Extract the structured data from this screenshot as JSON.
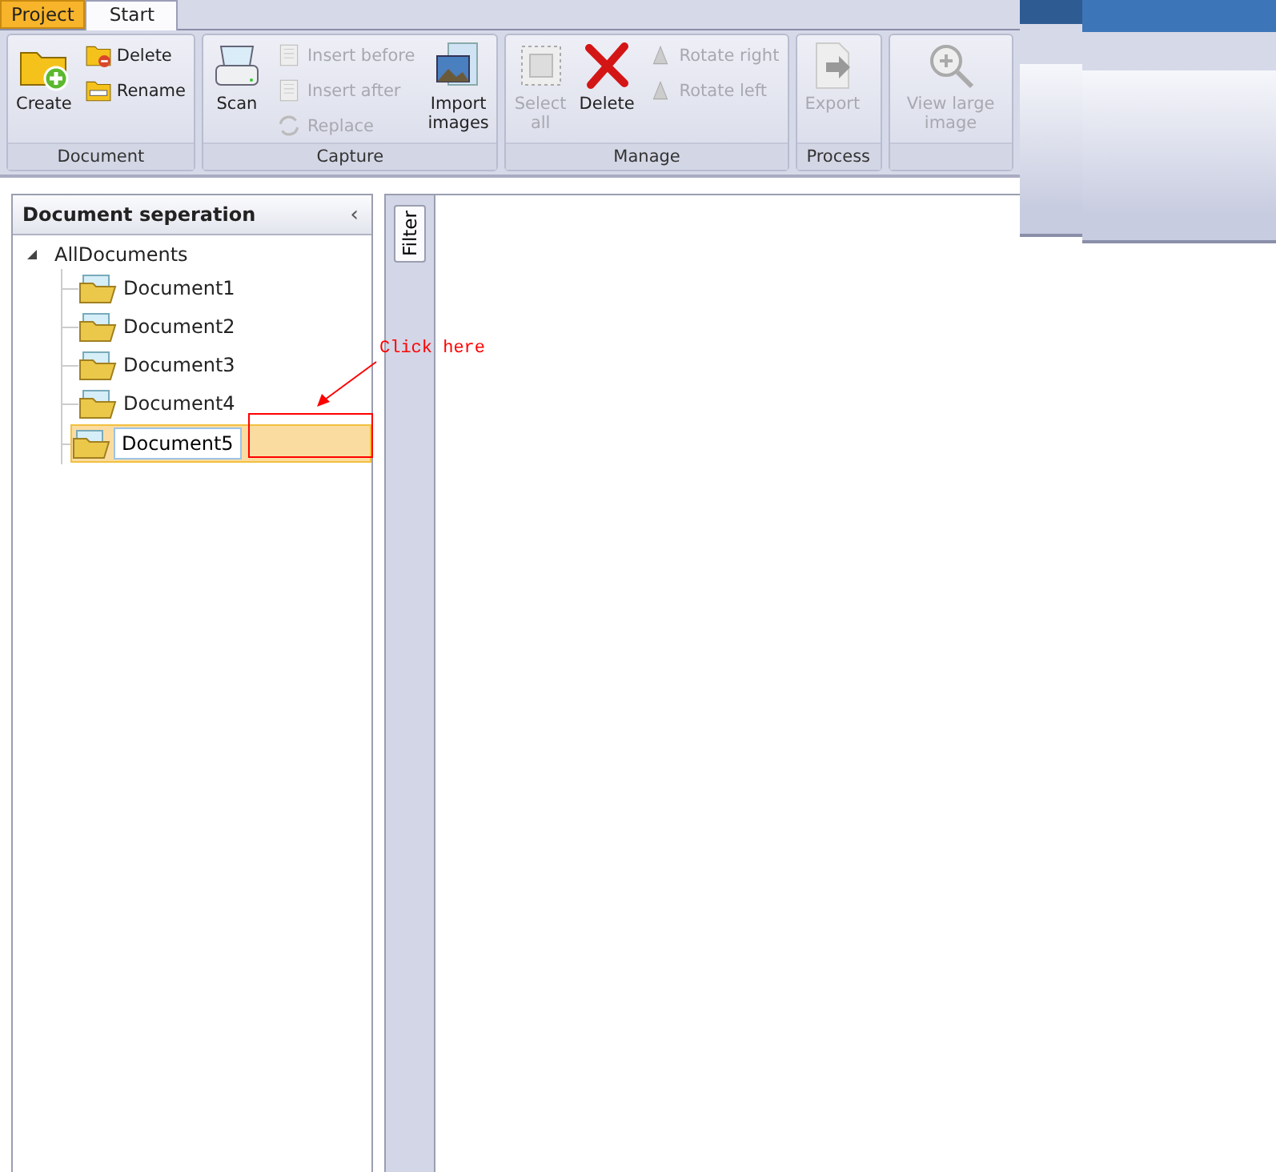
{
  "tabs": [
    {
      "label": "Project",
      "kind": "app",
      "selected": false
    },
    {
      "label": "Start",
      "kind": "tab",
      "selected": true
    }
  ],
  "ribbon": {
    "groups": [
      {
        "label": "Document",
        "columns": [
          [
            {
              "label": "Create",
              "kind": "large",
              "disabled": false
            }
          ],
          [
            {
              "label": "Delete",
              "kind": "small",
              "disabled": false
            },
            {
              "label": "Rename",
              "kind": "small",
              "disabled": false
            }
          ]
        ]
      },
      {
        "label": "Capture",
        "columns": [
          [
            {
              "label": "Scan",
              "kind": "large",
              "disabled": false
            }
          ],
          [
            {
              "label": "Insert before",
              "kind": "small",
              "disabled": true
            },
            {
              "label": "Insert after",
              "kind": "small",
              "disabled": true
            },
            {
              "label": "Replace",
              "kind": "small",
              "disabled": true
            }
          ],
          [
            {
              "label": "Import images",
              "kind": "large",
              "disabled": false
            }
          ]
        ]
      },
      {
        "label": "Manage",
        "columns": [
          [
            {
              "label": "Select all",
              "kind": "large",
              "disabled": true
            }
          ],
          [
            {
              "label": "Delete",
              "kind": "large",
              "disabled": false
            }
          ],
          [
            {
              "label": "Rotate right",
              "kind": "small",
              "disabled": true
            },
            {
              "label": "Rotate left",
              "kind": "small",
              "disabled": true
            }
          ]
        ]
      },
      {
        "label": "Process",
        "columns": [
          [
            {
              "label": "Export",
              "kind": "large",
              "disabled": true
            }
          ]
        ]
      },
      {
        "columns": [
          [
            {
              "label": "View large image",
              "kind": "large",
              "disabled": true
            }
          ]
        ]
      }
    ]
  },
  "panel": {
    "title": "Document seperation",
    "collapse": "‹",
    "tree": {
      "label": "AllDocuments",
      "expanded": true,
      "children": [
        {
          "label": "Document1",
          "selected": false,
          "editing": false
        },
        {
          "label": "Document2",
          "selected": false,
          "editing": false
        },
        {
          "label": "Document3",
          "selected": false,
          "editing": false
        },
        {
          "label": "Document4",
          "selected": false,
          "editing": false
        },
        {
          "label": "Document5",
          "selected": true,
          "editing": true
        }
      ]
    }
  },
  "filter_tab": "Filter",
  "annotation": {
    "text": "Click here"
  }
}
